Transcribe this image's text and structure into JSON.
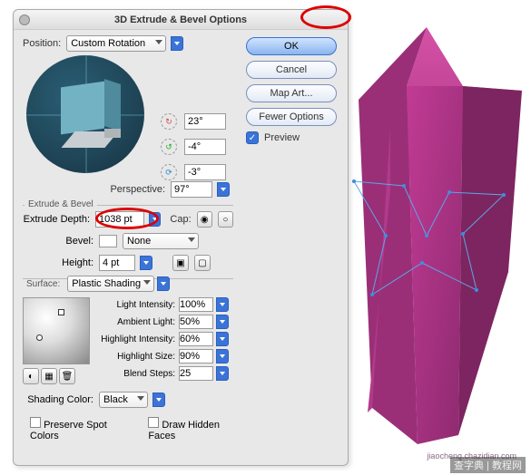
{
  "dialog_title": "3D Extrude & Bevel Options",
  "buttons": {
    "ok": "OK",
    "cancel": "Cancel",
    "mapart": "Map Art...",
    "fewer": "Fewer Options"
  },
  "preview_label": "Preview",
  "position": {
    "label": "Position:",
    "value": "Custom Rotation"
  },
  "angles": {
    "x": "23°",
    "y": "-4°",
    "z": "-3°"
  },
  "perspective": {
    "label": "Perspective:",
    "value": "97°"
  },
  "extrude_bevel": {
    "section": "Extrude & Bevel",
    "depth_label": "Extrude Depth:",
    "depth_value": "1038 pt",
    "cap_label": "Cap:",
    "bevel_label": "Bevel:",
    "bevel_value": "None",
    "height_label": "Height:",
    "height_value": "4 pt"
  },
  "surface": {
    "section": "Surface:",
    "value": "Plastic Shading",
    "light_intensity": {
      "label": "Light Intensity:",
      "value": "100%"
    },
    "ambient": {
      "label": "Ambient Light:",
      "value": "50%"
    },
    "highlight_int": {
      "label": "Highlight Intensity:",
      "value": "60%"
    },
    "highlight_size": {
      "label": "Highlight Size:",
      "value": "90%"
    },
    "blend_steps": {
      "label": "Blend Steps:",
      "value": "25"
    },
    "shading_color": {
      "label": "Shading Color:",
      "value": "Black"
    },
    "preserve": "Preserve Spot Colors",
    "hidden": "Draw Hidden Faces"
  },
  "watermark": "查字典 | 教程网",
  "watermark_sub": "jiaocheng.chazidian.com"
}
